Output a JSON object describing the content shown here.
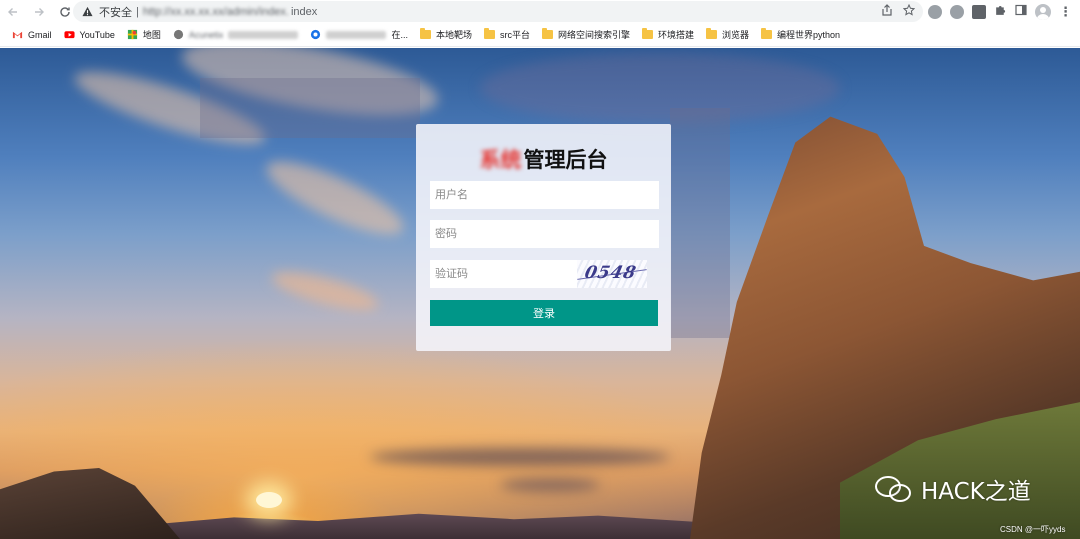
{
  "browser": {
    "omnibox": {
      "insecure_label": "不安全",
      "separator": "|",
      "url_blurred": "http://xx.xx.xx.xx/admin/index.",
      "url_tail": "index"
    },
    "bookmarks": [
      {
        "label": "Gmail",
        "icon": "gmail-icon"
      },
      {
        "label": "YouTube",
        "icon": "youtube-icon"
      },
      {
        "label": "地图",
        "icon": "maps-icon"
      },
      {
        "label": "Acunetix",
        "icon": "acunetix-icon",
        "blurred": true
      },
      {
        "label": "在...",
        "icon": "site-icon",
        "blurred_prefix": true
      },
      {
        "label": "本地靶场",
        "icon": "folder-icon"
      },
      {
        "label": "src平台",
        "icon": "folder-icon"
      },
      {
        "label": "网络空间搜索引擎",
        "icon": "folder-icon"
      },
      {
        "label": "环境搭建",
        "icon": "folder-icon"
      },
      {
        "label": "浏览器",
        "icon": "folder-icon"
      },
      {
        "label": "编程世界python",
        "icon": "folder-icon"
      }
    ]
  },
  "login": {
    "title_logo_text": "系统",
    "title_text": "管理后台",
    "username_placeholder": "用户名",
    "password_placeholder": "密码",
    "captcha_placeholder": "验证码",
    "captcha_code": "0548",
    "submit_label": "登录",
    "accent_color": "#009688"
  },
  "watermarks": {
    "brand": "HACK之道",
    "credit": "CSDN @一吓yyds"
  }
}
